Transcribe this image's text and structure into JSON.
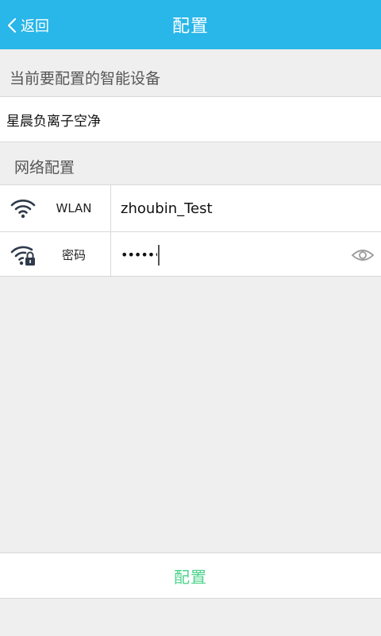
{
  "header": {
    "back_label": "返回",
    "title": "配置"
  },
  "device_section": {
    "label": "当前要配置的智能设备",
    "device_name": "星晨负离子空净"
  },
  "network_section": {
    "label": "网络配置",
    "wlan": {
      "label": "WLAN",
      "value": "zhoubin_Test",
      "icon": "wifi-icon"
    },
    "password": {
      "label": "密码",
      "value": "•••••••",
      "icon": "wifi-lock-icon",
      "toggle_icon": "eye-icon"
    }
  },
  "footer": {
    "config_button_label": "配置",
    "config_button_color": "#4cd38b"
  },
  "colors": {
    "header_bg": "#29b6e8",
    "page_bg": "#efefef"
  }
}
